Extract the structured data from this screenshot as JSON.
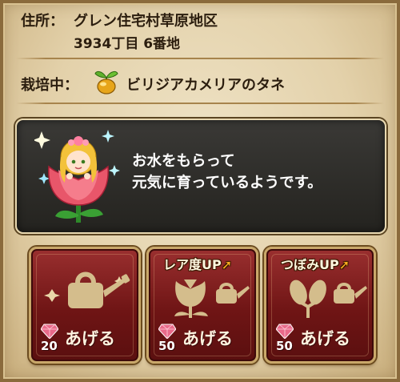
{
  "address": {
    "label": "住所：",
    "line1": "グレン住宅村草原地区",
    "line2": "3934丁目 6番地"
  },
  "cultivation": {
    "label": "栽培中：",
    "seed_icon": "golden-seed-icon",
    "seed_name": "ビリジアカメリアのタネ"
  },
  "message": {
    "portrait": "flower-fairy-portrait",
    "line1": "お水をもらって",
    "line2": "元気に育っているようです。"
  },
  "actions": [
    {
      "badge": "",
      "icon": "watering-can-icon",
      "cost": "20",
      "label": "あげる"
    },
    {
      "badge": "レア度UP",
      "icon": "tulip-watering-can-icon",
      "cost": "50",
      "label": "あげる"
    },
    {
      "badge": "つぼみUP",
      "icon": "bud-watering-can-icon",
      "cost": "50",
      "label": "あげる"
    }
  ],
  "colors": {
    "parchment": "#e3d1aa",
    "button_red": "#7a1c1c",
    "button_border": "#c9a86a",
    "message_bg": "#2e2d2a",
    "gem": "#e86a8a",
    "gold_art": "#d4bd8c"
  }
}
